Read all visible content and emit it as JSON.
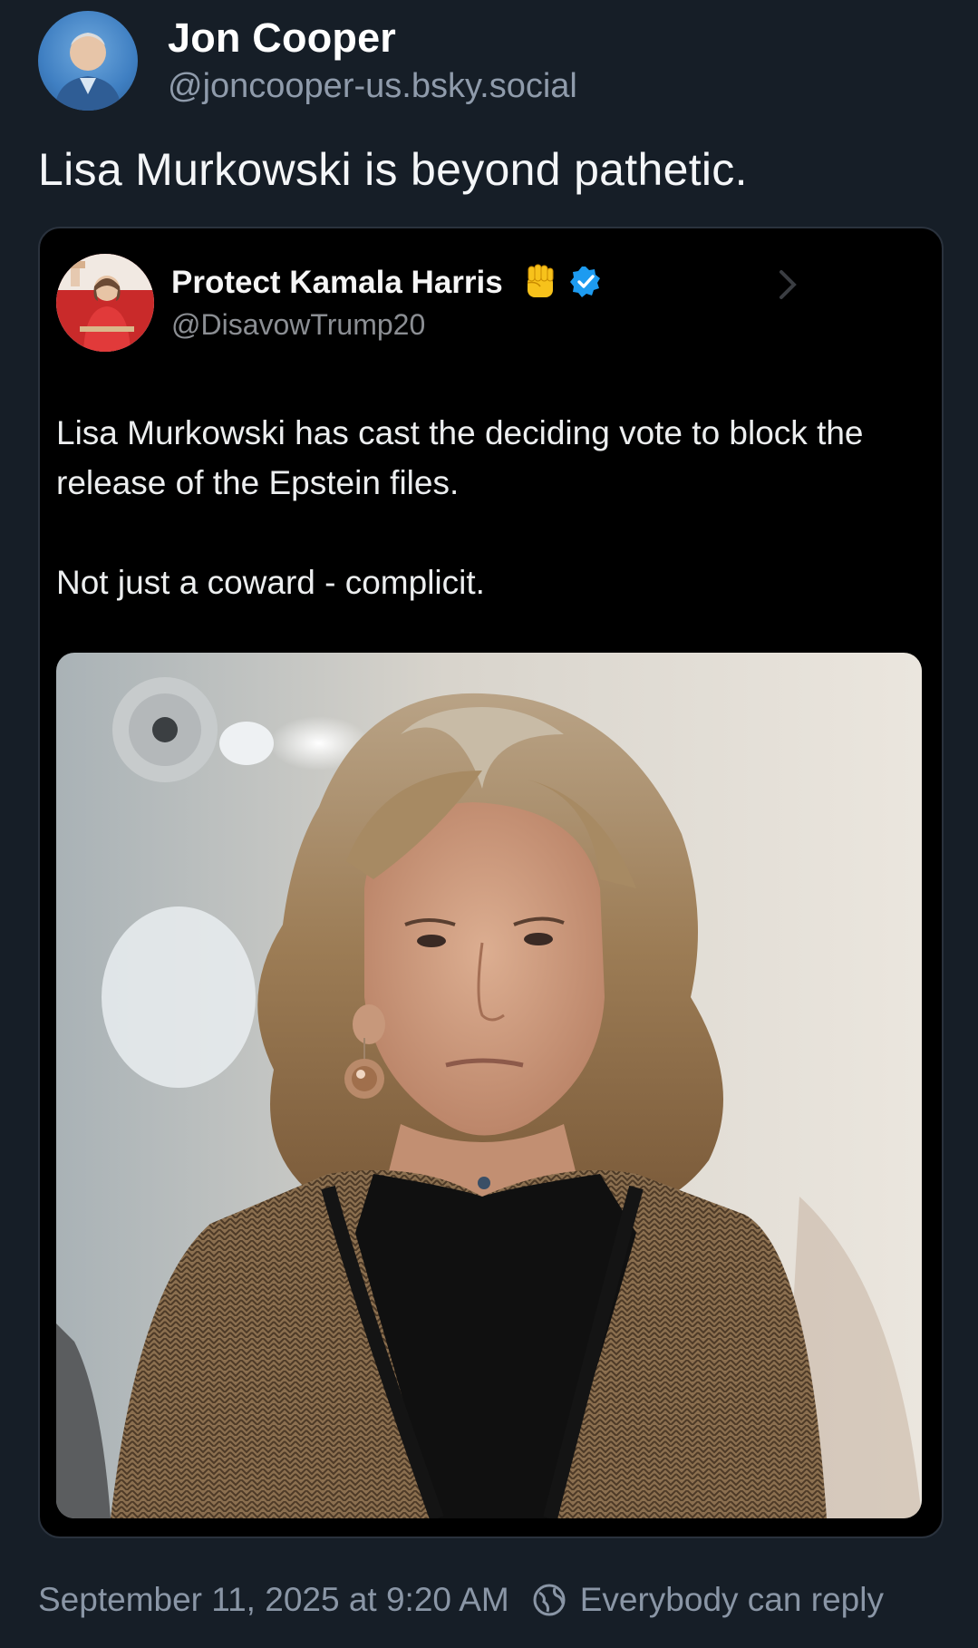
{
  "post": {
    "author": {
      "name": "Jon Cooper",
      "handle": "@joncooper-us.bsky.social"
    },
    "text": "Lisa Murkowski is beyond pathetic.",
    "embed": {
      "author": {
        "name": "Protect Kamala Harris",
        "handle": "@DisavowTrump20",
        "badge_icon": "raised-fist-emoji",
        "verified_icon": "verified-check-icon",
        "verified_color": "#1d9bf0"
      },
      "text_paragraphs": [
        "Lisa Murkowski has cast the deciding vote to block the release of the Epstein files.",
        "Not just a coward - complicit."
      ]
    },
    "footer": {
      "timestamp": "September 11, 2025 at 9:20 AM",
      "reply_setting": "Everybody can reply"
    }
  },
  "colors": {
    "background": "#161e27",
    "embed_background": "#000000",
    "muted_text": "#8a96a6",
    "accent_fist": "#f7c21b"
  }
}
